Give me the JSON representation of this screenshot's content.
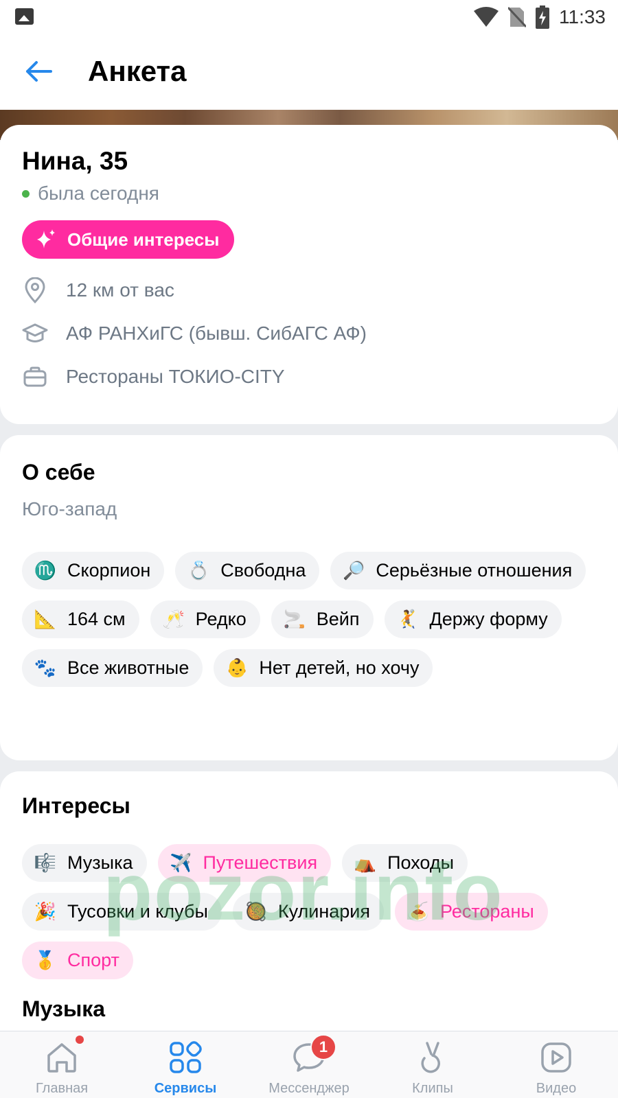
{
  "status_bar": {
    "time": "11:33",
    "icons": [
      "gallery-icon",
      "wifi-icon",
      "no-sim-icon",
      "battery-charging-icon"
    ]
  },
  "header": {
    "title": "Анкета",
    "back_icon": "arrow-left-icon"
  },
  "profile": {
    "name_age": "Нина, 35",
    "online_status": "была сегодня",
    "common_interests_label": "Общие интересы",
    "info": [
      {
        "icon": "location-pin-icon",
        "text": "12 км от вас"
      },
      {
        "icon": "graduation-cap-icon",
        "text": "АФ РАНХиГС (бывш. СибАГС АФ)"
      },
      {
        "icon": "briefcase-icon",
        "text": "Рестораны ТОКИО-CITY"
      }
    ]
  },
  "about": {
    "title": "О себе",
    "text": "Юго-запад",
    "chips": [
      {
        "emoji": "♏",
        "label": "Скорпион"
      },
      {
        "emoji": "💍",
        "label": "Свободна"
      },
      {
        "emoji": "🔎",
        "label": "Серьёзные отношения"
      },
      {
        "emoji": "📐",
        "label": "164 см"
      },
      {
        "emoji": "🥂",
        "label": "Редко"
      },
      {
        "emoji": "🚬",
        "label": "Вейп"
      },
      {
        "emoji": "🤾",
        "label": "Держу форму"
      },
      {
        "emoji": "🐾",
        "label": "Все животные"
      },
      {
        "emoji": "👶",
        "label": "Нет детей, но хочу"
      }
    ]
  },
  "interests": {
    "title": "Интересы",
    "chips": [
      {
        "emoji": "🎼",
        "label": "Музыка",
        "common": false
      },
      {
        "emoji": "✈️",
        "label": "Путешествия",
        "common": true
      },
      {
        "emoji": "⛺",
        "label": "Походы",
        "common": false
      },
      {
        "emoji": "🎉",
        "label": "Тусовки и клубы",
        "common": false
      },
      {
        "emoji": "🥘",
        "label": "Кулинария",
        "common": false
      },
      {
        "emoji": "🍝",
        "label": "Рестораны",
        "common": true
      },
      {
        "emoji": "🥇",
        "label": "Спорт",
        "common": true
      }
    ]
  },
  "next_section": {
    "title": "Музыка"
  },
  "watermark": "pozor.info",
  "tabbar": {
    "tabs": [
      {
        "label": "Главная",
        "icon": "home-icon"
      },
      {
        "label": "Сервисы",
        "icon": "services-grid-icon"
      },
      {
        "label": "Мессенджер",
        "icon": "messenger-icon",
        "badge": "1"
      },
      {
        "label": "Клипы",
        "icon": "clips-icon"
      },
      {
        "label": "Видео",
        "icon": "video-icon"
      }
    ],
    "active": "Сервисы"
  },
  "colors": {
    "accent_pink": "#ff2ba0",
    "accent_blue": "#2688eb",
    "online_green": "#4bb34b"
  }
}
